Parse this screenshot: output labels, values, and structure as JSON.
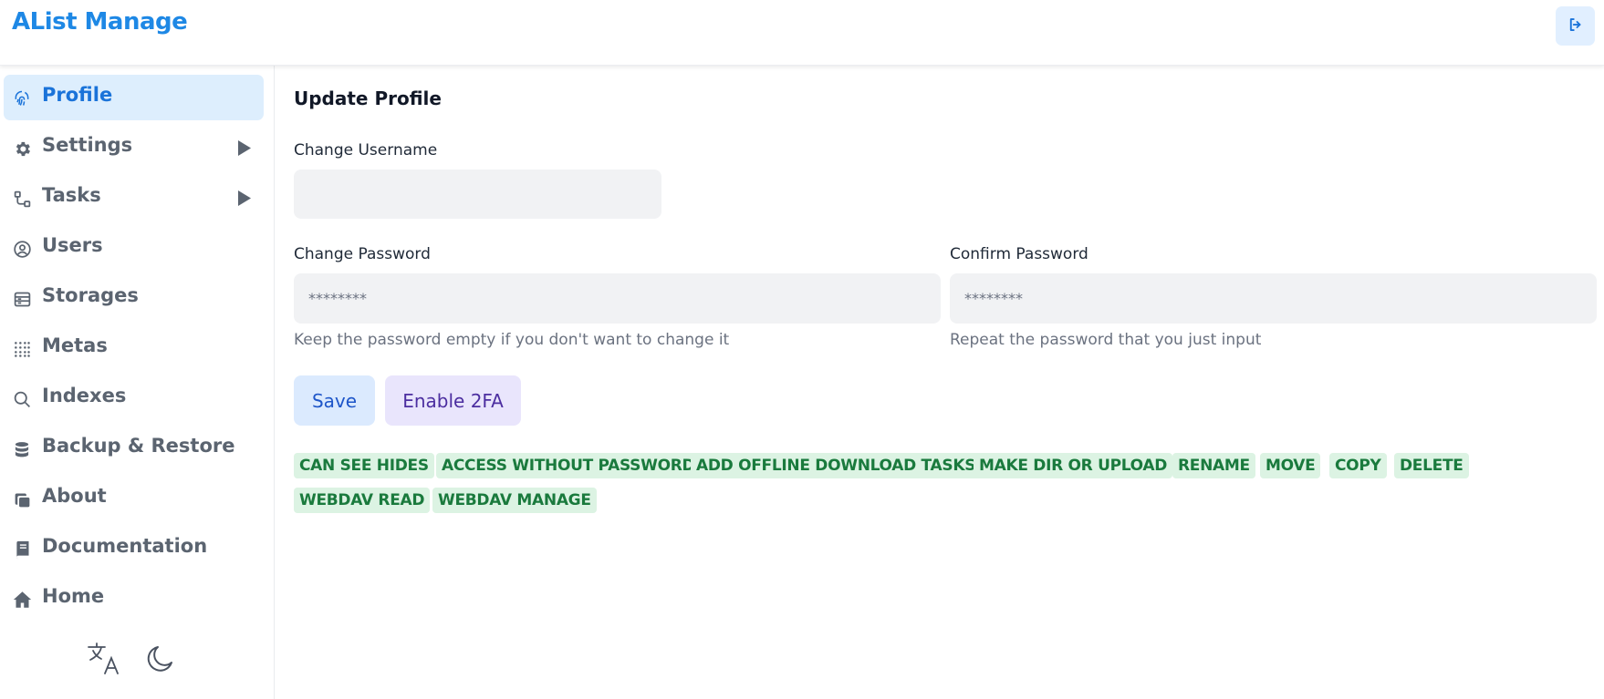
{
  "header": {
    "brand": "AList Manage",
    "logout_icon": "logout-icon"
  },
  "sidebar": {
    "items": [
      {
        "label": "Profile",
        "icon": "fingerprint-icon",
        "active": true
      },
      {
        "label": "Settings",
        "icon": "gear-icon",
        "expandable": true
      },
      {
        "label": "Tasks",
        "icon": "workflow-icon",
        "expandable": true
      },
      {
        "label": "Users",
        "icon": "user-circle-icon"
      },
      {
        "label": "Storages",
        "icon": "storage-icon"
      },
      {
        "label": "Metas",
        "icon": "grid-dots-icon"
      },
      {
        "label": "Indexes",
        "icon": "search-icon"
      },
      {
        "label": "Backup & Restore",
        "icon": "database-icon"
      },
      {
        "label": "About",
        "icon": "copy-icon"
      },
      {
        "label": "Documentation",
        "icon": "book-icon"
      },
      {
        "label": "Home",
        "icon": "home-icon"
      }
    ],
    "tools": [
      "translate-icon",
      "moon-icon"
    ]
  },
  "main": {
    "title": "Update Profile",
    "username": {
      "label": "Change Username",
      "value": ""
    },
    "password": {
      "label": "Change Password",
      "placeholder": "********",
      "helper": "Keep the password empty if you don't want to change it"
    },
    "confirm": {
      "label": "Confirm Password",
      "placeholder": "********",
      "helper": "Repeat the password that you just input"
    },
    "save_label": "Save",
    "enable_2fa_label": "Enable 2FA",
    "permissions": [
      "CAN SEE HIDES",
      "ACCESS WITHOUT PASSWORD",
      "ADD OFFLINE DOWNLOAD TASKS",
      "MAKE DIR OR UPLOAD",
      "RENAME",
      "MOVE",
      "COPY",
      "DELETE",
      "WEBDAV READ",
      "WEBDAV MANAGE"
    ]
  },
  "colors": {
    "brand": "#1e88e5",
    "active_bg": "#ddeefd",
    "tag_bg": "#dcf3e3",
    "tag_text": "#1a7a3d"
  }
}
